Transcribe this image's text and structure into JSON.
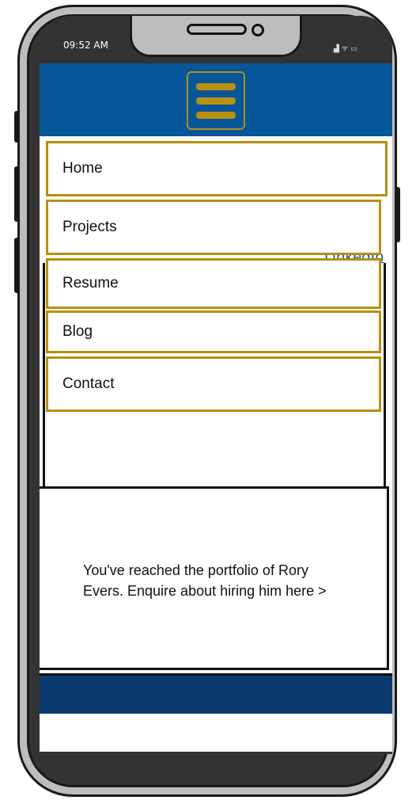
{
  "status_bar": {
    "time": "09:52 AM",
    "icons": [
      "signal-icon",
      "wifi-icon",
      "battery-icon"
    ]
  },
  "header": {
    "menu_icon": "hamburger-menu-icon"
  },
  "nav_menu": {
    "items": [
      {
        "label": "Home"
      },
      {
        "label": "Projects"
      },
      {
        "label": "Resume"
      },
      {
        "label": "Blog"
      },
      {
        "label": "Contact"
      }
    ]
  },
  "background_link": {
    "text": "LinkedIn"
  },
  "intro": {
    "text": "You've reached the portfolio of Rory Evers. Enquire about hiring him here >"
  },
  "colors": {
    "header_bg": "#07569a",
    "accent_gold": "#b8900e",
    "footer_bg": "#0a3a6e"
  }
}
